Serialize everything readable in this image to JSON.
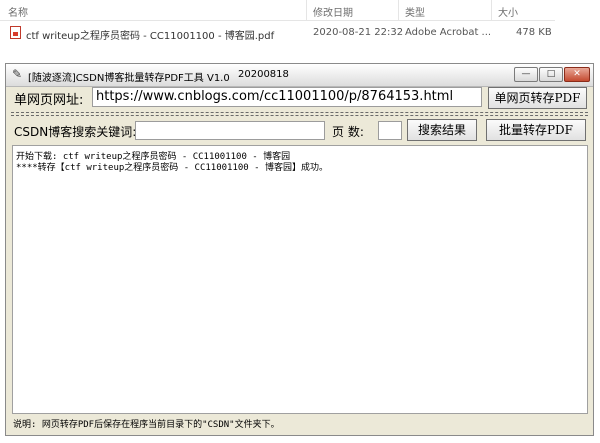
{
  "explorer": {
    "columns": {
      "name": "名称",
      "modified": "修改日期",
      "type": "类型",
      "size": "大小"
    },
    "file": {
      "name": "ctf writeup之程序员密码 - CC11001100 - 博客园.pdf",
      "modified": "2020-08-21 22:32",
      "type": "Adobe Acrobat ...",
      "size": "478 KB"
    }
  },
  "window": {
    "title": "[随波逐流]CSDN博客批量转存PDF工具 V1.0",
    "version": "20200818",
    "controls": {
      "minimize": "—",
      "maximize": "□",
      "close": "✕"
    }
  },
  "single": {
    "label": "单网页网址:",
    "url": "https://www.cnblogs.com/cc11001100/p/8764153.html",
    "button": "单网页转存PDF"
  },
  "search": {
    "label": "CSDN博客搜索关键词:",
    "keyword": "",
    "pages_label": "页  数:",
    "pages_value": "",
    "search_button": "搜索结果",
    "batch_button": "批量转存PDF"
  },
  "log": [
    "开始下载: ctf writeup之程序员密码 - CC11001100 - 博客园",
    "****转存【ctf writeup之程序员密码 - CC11001100 - 博客园】成功。"
  ],
  "status": "说明: 网页转存PDF后保存在程序当前目录下的\"CSDN\"文件夹下。"
}
